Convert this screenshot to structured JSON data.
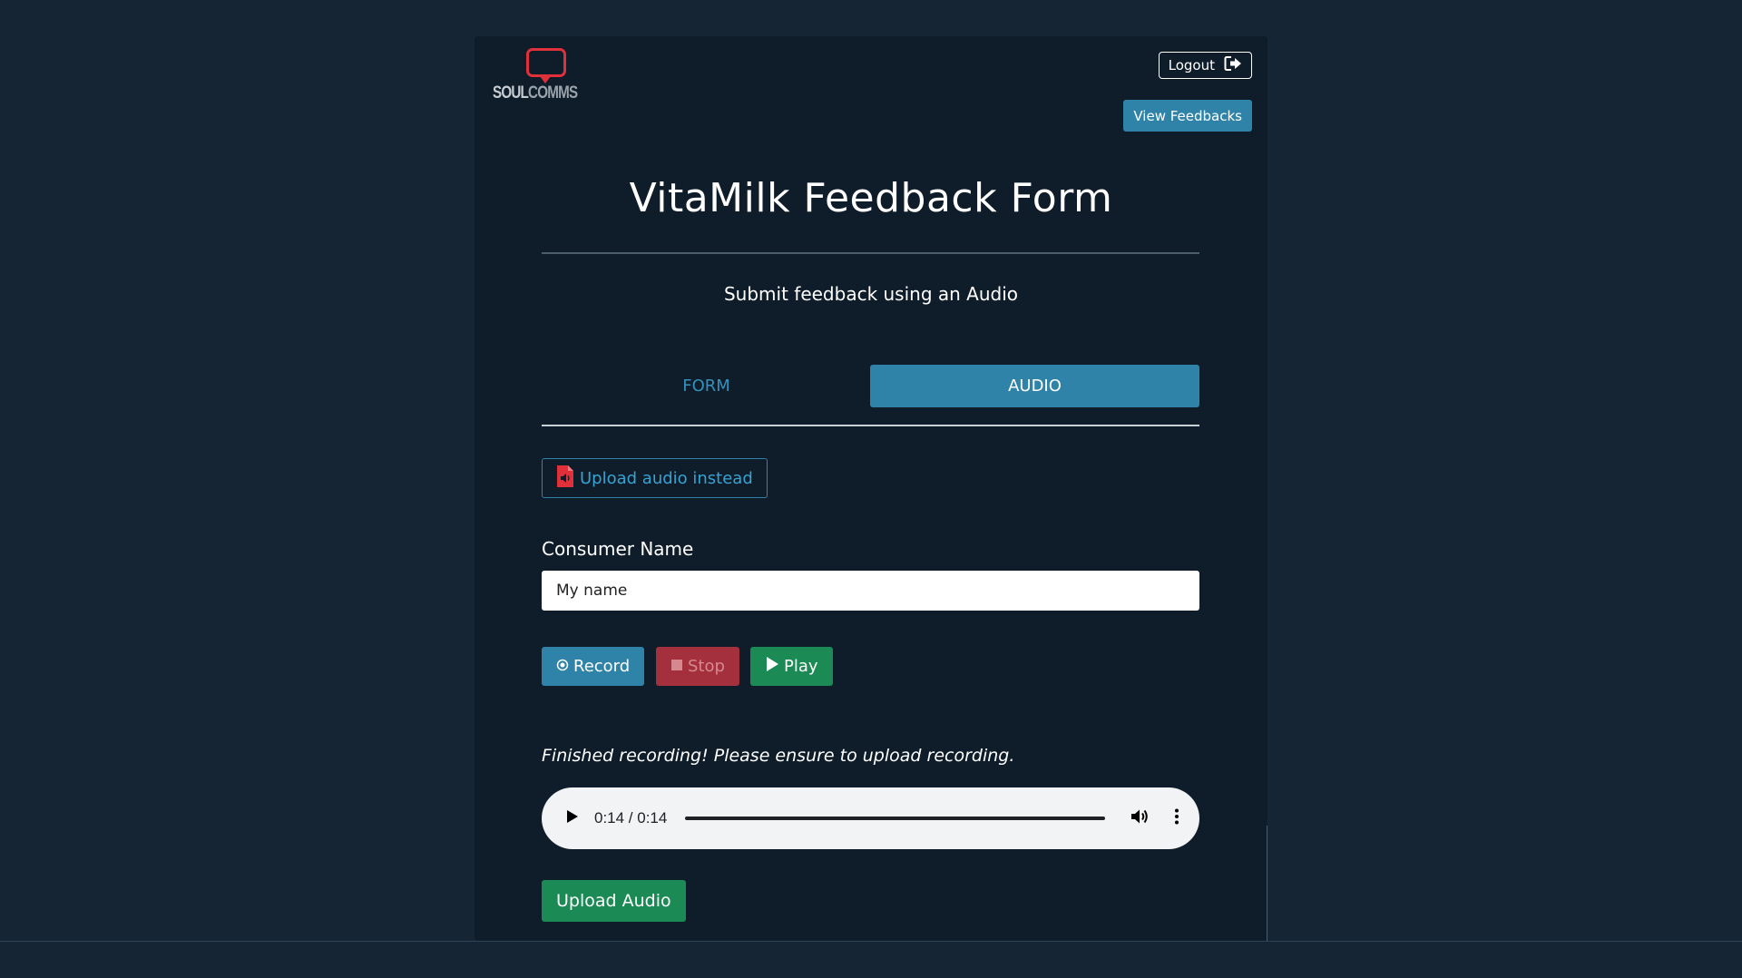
{
  "header": {
    "logo": {
      "text_bold": "SOUL",
      "text_light": "COMMS"
    },
    "logout_label": "Logout",
    "view_feedbacks_label": "View Feedbacks"
  },
  "main": {
    "title": "VitaMilk Feedback Form",
    "subtitle": "Submit feedback using an Audio",
    "tabs": [
      {
        "label": "FORM",
        "active": false
      },
      {
        "label": "AUDIO",
        "active": true
      }
    ],
    "upload_instead_label": "Upload audio instead",
    "consumer_name_label": "Consumer Name",
    "consumer_name_value": "My name",
    "controls": {
      "record_label": "Record",
      "stop_label": "Stop",
      "play_label": "Play"
    },
    "status_text": "Finished recording! Please ensure to upload recording.",
    "audio_player": {
      "time": "0:14 / 0:14",
      "progress": 1.0
    },
    "upload_audio_label": "Upload Audio"
  },
  "colors": {
    "page_bg": "#162533",
    "card_bg": "#0f1d2b",
    "primary": "#2f83a9",
    "danger": "#a5303d",
    "success": "#1c8a54",
    "logo_red": "#e0303a"
  }
}
